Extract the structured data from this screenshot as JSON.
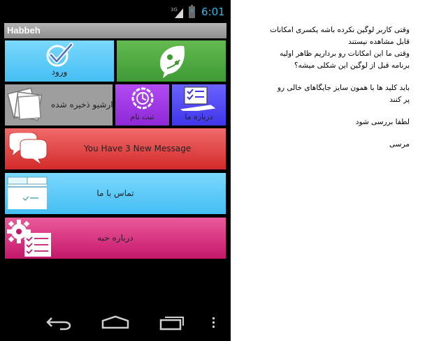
{
  "status_bar": {
    "network": "3G",
    "time": "6:01",
    "accent": "#35b5e5"
  },
  "action_bar": {
    "title": "Habbeh"
  },
  "tiles": {
    "login": {
      "label": "ورود",
      "icon": "checkmark-circle-icon",
      "color": "#44bef4"
    },
    "logo": {
      "icon": "leaf-icon",
      "color": "#3f9a36"
    },
    "archive": {
      "label": "ارشیو ذخیره شده",
      "icon": "stacked-papers-icon",
      "color": "#9e9e9e"
    },
    "register": {
      "label": "ثبت نام",
      "icon": "timer-icon",
      "color": "#8e28d8"
    },
    "about_small": {
      "label": "درباره ما",
      "icon": "checklist-laptop-icon",
      "color": "#4035e9"
    },
    "messages": {
      "label": "You Have  3  New Message",
      "icon": "chat-bubbles-icon",
      "color": "#d32a2a"
    },
    "contact": {
      "label": "تماس با ما",
      "icon": "form-icon",
      "color": "#44bef4"
    },
    "about_app": {
      "label": "درباره حبه",
      "icon": "settings-checklist-icon",
      "color": "#c5176b"
    }
  },
  "nav_bar": {
    "back": "back-icon",
    "home": "home-icon",
    "recent": "recent-apps-icon",
    "menu": "overflow-menu-icon"
  },
  "note": {
    "lines": [
      "وقتی کاربر لوگین نکرده باشه یکسری امکانات",
      "قابل مشاهده نیستند",
      "وقتی ما این امکانات رو برداریم ظاهر اولیه",
      "برنامه قبل از لوگین این شکلی میشه؟",
      "باید کلید ها با همون سایز جایگاهای خالی رو",
      "پر کنند",
      "لطفا بررسی شود",
      "مرسی"
    ]
  }
}
